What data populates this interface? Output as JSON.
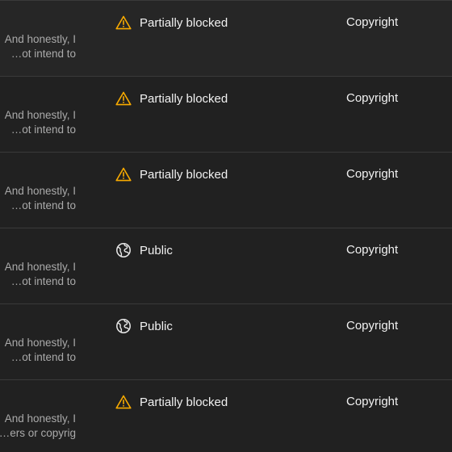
{
  "rows": [
    {
      "description_line1": "And honestly, I",
      "description_line2": "ot intend to…",
      "visibility": "Partially blocked",
      "visibility_icon": "warning-icon",
      "restrictions": "Copyright"
    },
    {
      "description_line1": "And honestly, I",
      "description_line2": "ot intend to…",
      "visibility": "Partially blocked",
      "visibility_icon": "warning-icon",
      "restrictions": "Copyright"
    },
    {
      "description_line1": "And honestly, I",
      "description_line2": "ot intend to…",
      "visibility": "Partially blocked",
      "visibility_icon": "warning-icon",
      "restrictions": "Copyright"
    },
    {
      "description_line1": "And honestly, I",
      "description_line2": "ot intend to…",
      "visibility": "Public",
      "visibility_icon": "globe-icon",
      "restrictions": "Copyright"
    },
    {
      "description_line1": "And honestly, I",
      "description_line2": "ot intend to…",
      "visibility": "Public",
      "visibility_icon": "globe-icon",
      "restrictions": "Copyright"
    },
    {
      "description_line1": "And honestly, I",
      "description_line2": "ers or copyrig…",
      "visibility": "Partially blocked",
      "visibility_icon": "warning-icon",
      "restrictions": "Copyright"
    }
  ],
  "colors": {
    "background": "#212121",
    "divider": "#3a3a3a",
    "text": "#f1f1f1",
    "muted_text": "#aaaaaa",
    "warning": "#f9ab00",
    "icon": "#e8e8e8"
  }
}
